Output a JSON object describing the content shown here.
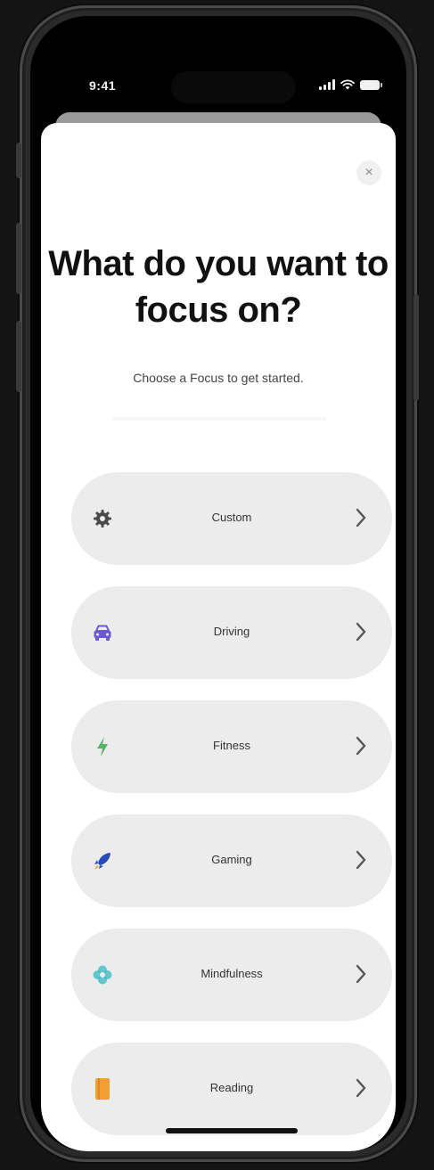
{
  "status_bar": {
    "time": "9:41",
    "icons": [
      "signal-icon",
      "wifi-icon",
      "battery-icon"
    ]
  },
  "sheet": {
    "close_label": "×",
    "title": "What do you want to focus on?",
    "subtitle": "Choose a Focus to get started."
  },
  "options": [
    {
      "label": "Custom",
      "icon": "gear-icon",
      "icon_color": "#4a4a4a"
    },
    {
      "label": "Driving",
      "icon": "car-icon",
      "icon_color": "#6a5acd"
    },
    {
      "label": "Fitness",
      "icon": "bolt-icon",
      "icon_color": "#58b368"
    },
    {
      "label": "Gaming",
      "icon": "rocket-icon",
      "icon_color": "#2a4bb5"
    },
    {
      "label": "Mindfulness",
      "icon": "flower-icon",
      "icon_color": "#36b9c2"
    },
    {
      "label": "Reading",
      "icon": "book-icon",
      "icon_color": "#f0a030"
    }
  ],
  "colors": {
    "background": "#141414",
    "sheet": "#ffffff",
    "option_background": "#ececec",
    "title": "#111111"
  }
}
